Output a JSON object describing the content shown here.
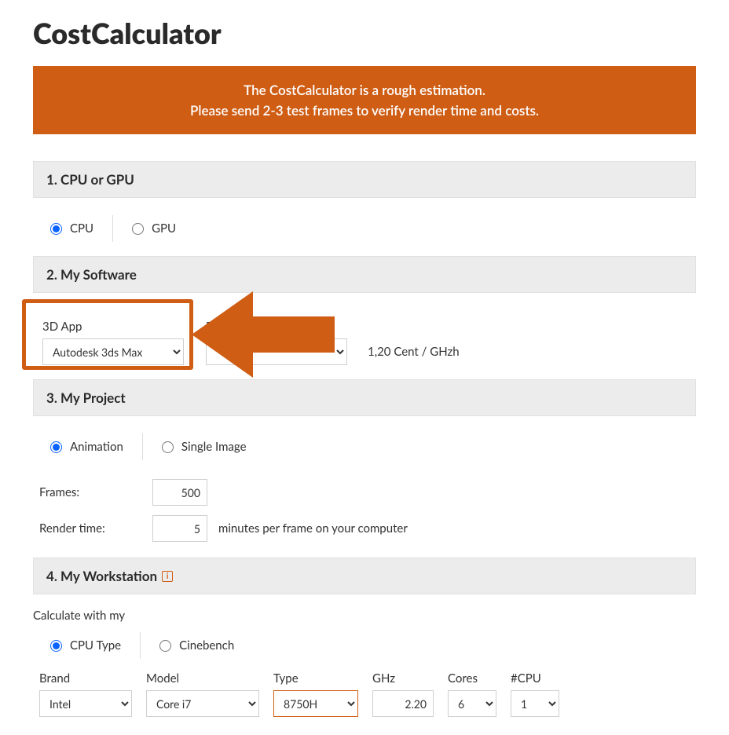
{
  "title": "CostCalculator",
  "banner": {
    "line1": "The CostCalculator is a rough estimation.",
    "line2": "Please send 2-3 test frames to verify render time and costs."
  },
  "section1": {
    "heading": "1. CPU or GPU",
    "opt_cpu": "CPU",
    "opt_gpu": "GPU"
  },
  "section2": {
    "heading": "2. My Software",
    "app_label": "3D App",
    "app_value": "Autodesk 3ds Max",
    "renderer_label": "Renderer",
    "price": "1,20 Cent / GHzh"
  },
  "section3": {
    "heading": "3. My Project",
    "opt_anim": "Animation",
    "opt_single": "Single Image",
    "frames_label": "Frames:",
    "frames_value": "500",
    "rendertime_label": "Render time:",
    "rendertime_value": "5",
    "rendertime_suffix": "minutes per frame on your computer"
  },
  "section4": {
    "heading": "4. My Workstation",
    "calc_label": "Calculate with my",
    "opt_cputype": "CPU Type",
    "opt_cinebench": "Cinebench",
    "brand_label": "Brand",
    "brand_value": "Intel",
    "model_label": "Model",
    "model_value": "Core i7",
    "type_label": "Type",
    "type_value": "8750H",
    "ghz_label": "GHz",
    "ghz_value": "2.20",
    "cores_label": "Cores",
    "cores_value": "6",
    "ncpu_label": "#CPU",
    "ncpu_value": "1"
  }
}
